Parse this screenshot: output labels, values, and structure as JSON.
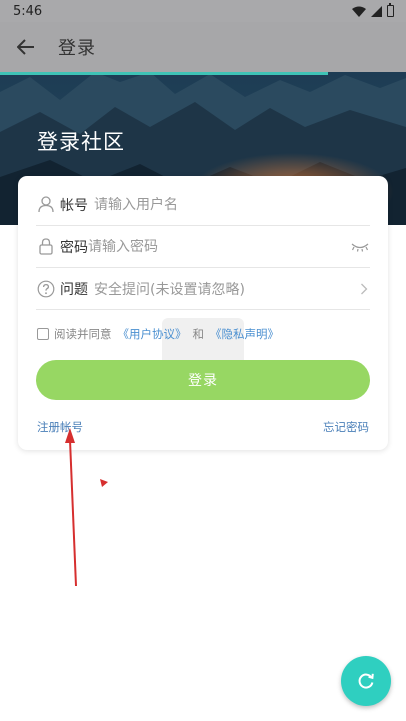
{
  "status_bar": {
    "time": "5:46"
  },
  "toolbar": {
    "title": "登录"
  },
  "banner": {
    "title": "登录社区"
  },
  "form": {
    "username": {
      "label": "帐号",
      "placeholder": "请输入用户名"
    },
    "password": {
      "label": "密码",
      "placeholder": "请输入密码"
    },
    "question": {
      "label": "问题",
      "value": "安全提问(未设置请忽略)"
    },
    "agreement": {
      "prefix": "阅读并同意",
      "user_agreement": "《用户协议》",
      "and": "和",
      "privacy": "《隐私声明》"
    },
    "login_button": "登录",
    "register_link": "注册帐号",
    "forgot_link": "忘记密码"
  },
  "colors": {
    "accent": "#3fc3b6",
    "login_button": "#97d763",
    "fab": "#2fcfc0",
    "annotation": "#d62f2f",
    "link": "#4a7fb8"
  },
  "icons": {
    "back": "arrow-left-icon",
    "user": "user-icon",
    "lock": "lock-icon",
    "question": "question-circle-icon",
    "eye": "eye-closed-icon",
    "chevron": "chevron-right-icon",
    "fab": "refresh-icon"
  }
}
